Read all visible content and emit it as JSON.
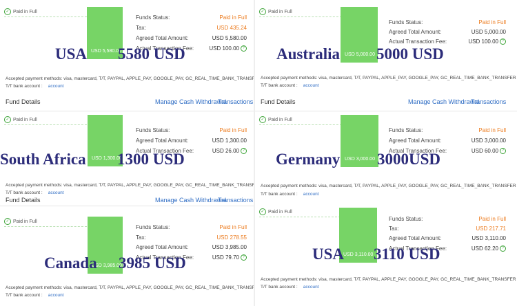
{
  "common": {
    "paid_in_full": "Paid in Full",
    "funds_status_label": "Funds Status:",
    "tax_label": "Tax:",
    "agreed_label": "Agreed Total Amount:",
    "fee_label": "Actual Transaction Fee:",
    "payment_methods": "Accepted payment methods: visa, mastercard, T/T, PAYPAL, APPLE_PAY, GOOGLE_PAY, GC_REAL_TIME_BANK_TRANSFER",
    "tt_label": "T/T bank account :",
    "account_link": "account",
    "fund_details_title": "Fund Details",
    "manage_link": "Manage Cash Withdrawal",
    "transactions_link": "Transactions"
  },
  "panels": [
    {
      "bar_amount": "USD 5,580.00",
      "funds_status": "Paid in Full",
      "tax": "USD 435.24",
      "agreed": "USD 5,580.00",
      "fee": "USD 100.00",
      "country": "USA",
      "overlay_amount": "5580 USD"
    },
    {
      "bar_amount": "USD 5,000.00",
      "funds_status": "Paid in Full",
      "agreed": "USD 5,000.00",
      "fee": "USD 100.00",
      "country": "Australia",
      "overlay_amount": "5000 USD"
    },
    {
      "bar_amount": "USD 1,300.00",
      "funds_status": "Paid in Full",
      "agreed": "USD 1,300.00",
      "fee": "USD 26.00",
      "country": "South Africa",
      "overlay_amount": "1300 USD"
    },
    {
      "bar_amount": "USD 3,000.00",
      "funds_status": "Paid in Full",
      "agreed": "USD 3,000.00",
      "fee": "USD 60.00",
      "country": "Germany",
      "overlay_amount": "3000USD"
    },
    {
      "bar_amount": "USD 3,985.00",
      "funds_status": "Paid in Full",
      "tax": "USD 278.55",
      "agreed": "USD 3,985.00",
      "fee": "USD 79.70",
      "country": "Canada",
      "overlay_amount": "3985 USD"
    },
    {
      "bar_amount": "USD 3,110.00",
      "funds_status": "Paid in Full",
      "tax": "USD 217.71",
      "agreed": "USD 3,110.00",
      "fee": "USD 62.20",
      "country": "USA",
      "overlay_amount": "3110 USD"
    }
  ],
  "colors": {
    "bar": "#77d466",
    "paid_status": "#ec7a1c",
    "link": "#2f6dc4",
    "overlay_text": "#2c2c7a"
  }
}
